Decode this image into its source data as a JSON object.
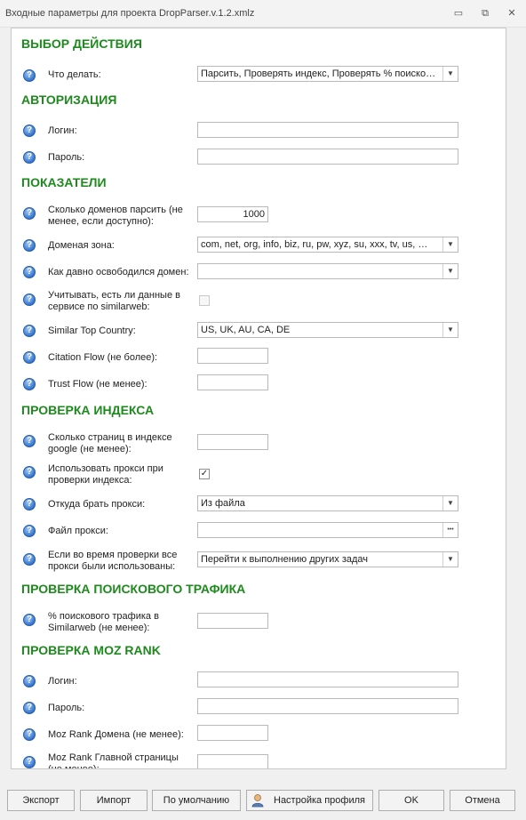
{
  "window": {
    "title": "Входные параметры для проекта DropParser.v.1.2.xmlz",
    "minimize": "▭",
    "restore": "⧉",
    "close": "✕"
  },
  "sections": {
    "action": "ВЫБОР ДЕЙСТВИЯ",
    "auth": "АВТОРИЗАЦИЯ",
    "metrics": "ПОКАЗАТЕЛИ",
    "index": "ПРОВЕРКА ИНДЕКСА",
    "traffic": "ПРОВЕРКА ПОИСКОВОГО ТРАФИКА",
    "moz": "ПРОВЕРКА MOZ RANK"
  },
  "fields": {
    "what_to_do": {
      "label": "Что делать:",
      "value": "Парсить, Проверять индекс, Проверять % поиско…"
    },
    "login": {
      "label": "Логин:",
      "value": ""
    },
    "password": {
      "label": "Пароль:",
      "value": ""
    },
    "domain_count": {
      "label": "Сколько доменов парсить (не менее, если доступно):",
      "value": "1000"
    },
    "domain_zone": {
      "label": "Доменая зона:",
      "value": "com, net, org, info, biz, ru, pw, xyz, su, xxx, tv, us, …"
    },
    "freed_when": {
      "label": "Как давно освободился домен:",
      "value": ""
    },
    "similarweb_data": {
      "label": "Учитывать, есть ли данные в сервисе по similarweb:",
      "checked": false
    },
    "similar_top_country": {
      "label": "Similar Top Country:",
      "value": "US, UK, AU, CA, DE"
    },
    "citation_flow": {
      "label": "Citation Flow (не более):",
      "value": ""
    },
    "trust_flow": {
      "label": "Trust Flow (не менее):",
      "value": ""
    },
    "pages_in_index": {
      "label": "Сколько страниц в индексе google (не менее):",
      "value": ""
    },
    "use_proxy": {
      "label": "Использовать прокси при проверки индекса:",
      "checked": true
    },
    "proxy_source": {
      "label": "Откуда брать прокси:",
      "value": "Из файла"
    },
    "proxy_file": {
      "label": "Файл прокси:",
      "value": ""
    },
    "proxies_used": {
      "label": "Если во время проверки все прокси были использованы:",
      "value": "Перейти к выполнению других задач"
    },
    "search_traffic": {
      "label": "% поискового трафика в Similarweb (не менее):",
      "value": ""
    },
    "moz_login": {
      "label": "Логин:",
      "value": ""
    },
    "moz_password": {
      "label": "Пароль:",
      "value": ""
    },
    "moz_domain": {
      "label": "Moz Rank Домена (не менее):",
      "value": ""
    },
    "moz_main_page": {
      "label": "Moz Rank Главной страницы (не менее):",
      "value": ""
    }
  },
  "icons": {
    "help": "?",
    "dropdown": "▼",
    "browse": "•••",
    "check": "✓",
    "scroll_up": "▲",
    "scroll_down": "▼"
  },
  "buttons": {
    "export": "Экспорт",
    "import": "Импорт",
    "defaults": "По умолчанию",
    "profile": "Настройка профиля",
    "ok": "OK",
    "cancel": "Отмена"
  }
}
